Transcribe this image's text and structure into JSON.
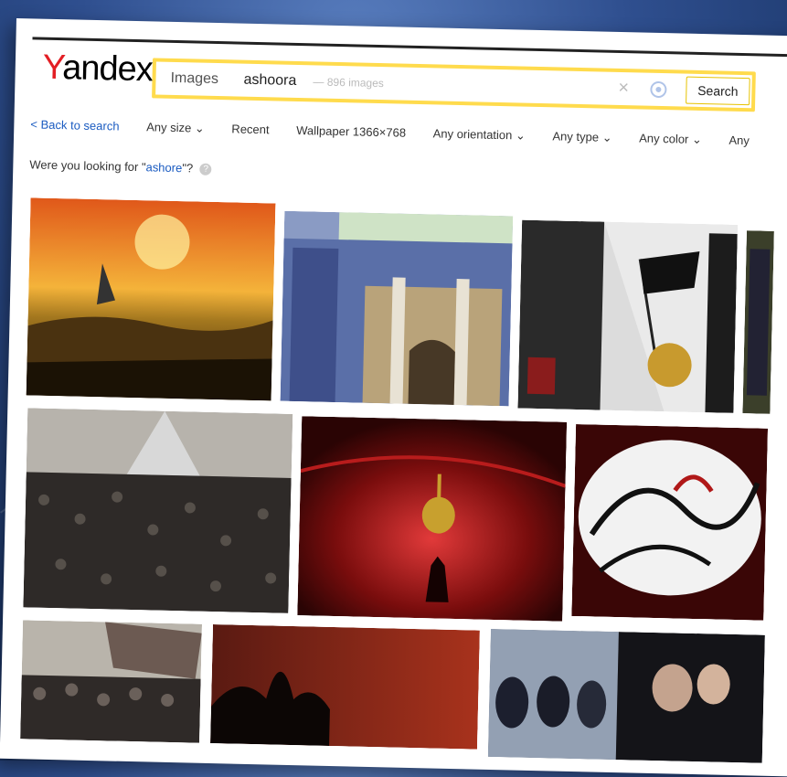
{
  "brand": {
    "logo_text": "Yandex"
  },
  "search": {
    "tab_label": "Images",
    "query": "ashoora",
    "meta": "— 896 images",
    "button_label": "Search"
  },
  "filters": {
    "back": "< Back to search",
    "items": [
      "Any size ⌄",
      "Recent",
      "Wallpaper 1366×768",
      "Any orientation ⌄",
      "Any type ⌄",
      "Any color ⌄",
      "Any"
    ]
  },
  "suggestion": {
    "prefix": "Were you looking for \"",
    "term": "ashore",
    "suffix": "\"?"
  },
  "results": {
    "tiles": [
      {
        "name": "result-image-1",
        "theme": "sunset-battle"
      },
      {
        "name": "result-image-2",
        "theme": "shrine-facade"
      },
      {
        "name": "result-image-3",
        "theme": "black-flag"
      },
      {
        "name": "result-image-4",
        "theme": "crowd"
      },
      {
        "name": "result-image-5",
        "theme": "red-dome"
      },
      {
        "name": "result-image-6",
        "theme": "calligraphy"
      },
      {
        "name": "result-image-7",
        "theme": "crowd-banner"
      },
      {
        "name": "result-image-8",
        "theme": "dark-domes"
      },
      {
        "name": "result-image-9",
        "theme": "veiled-women"
      }
    ]
  },
  "colors": {
    "accent": "#ffdb4d",
    "link": "#1a5bc1",
    "brand_red": "#e31e24"
  }
}
